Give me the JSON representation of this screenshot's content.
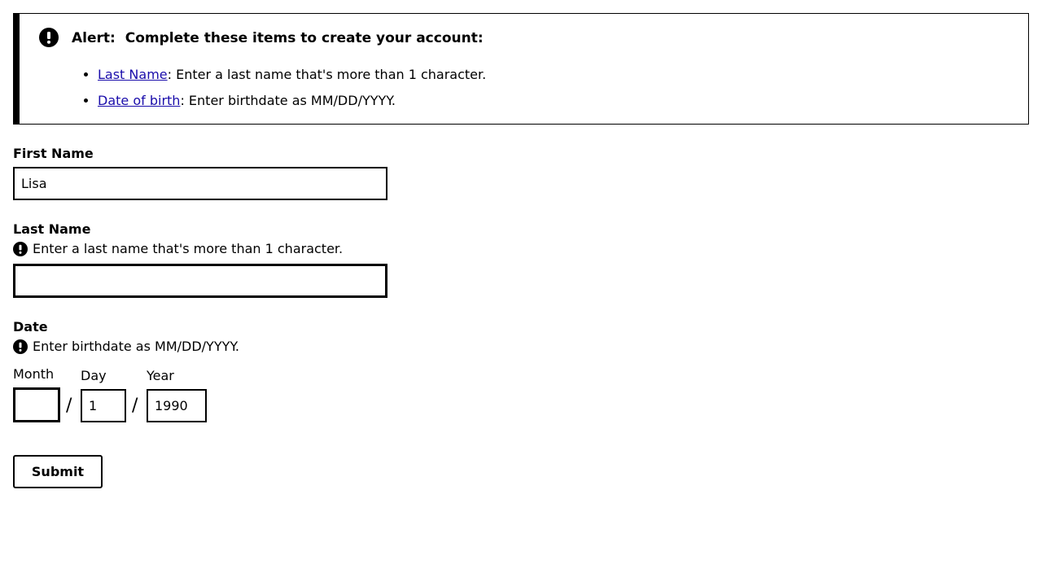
{
  "alert": {
    "prefix": "Alert:",
    "title": "Complete these items to create your account:",
    "items": [
      {
        "link": "Last Name",
        "text": ": Enter a last name that's more than 1 character."
      },
      {
        "link": "Date of birth",
        "text": ": Enter birthdate as MM/DD/YYYY."
      }
    ],
    "icon": "exclamation-circle-icon"
  },
  "form": {
    "first_name": {
      "label": "First Name",
      "value": "Lisa"
    },
    "last_name": {
      "label": "Last Name",
      "error": "Enter a last name that's more than 1 character.",
      "value": ""
    },
    "date": {
      "label": "Date",
      "error": "Enter birthdate as MM/DD/YYYY.",
      "month": {
        "label": "Month",
        "value": ""
      },
      "day": {
        "label": "Day",
        "value": "1"
      },
      "year": {
        "label": "Year",
        "value": "1990"
      },
      "separator": "/"
    },
    "submit_label": "Submit"
  },
  "colors": {
    "link": "#1a0dab",
    "border": "#000000",
    "background": "#ffffff"
  }
}
